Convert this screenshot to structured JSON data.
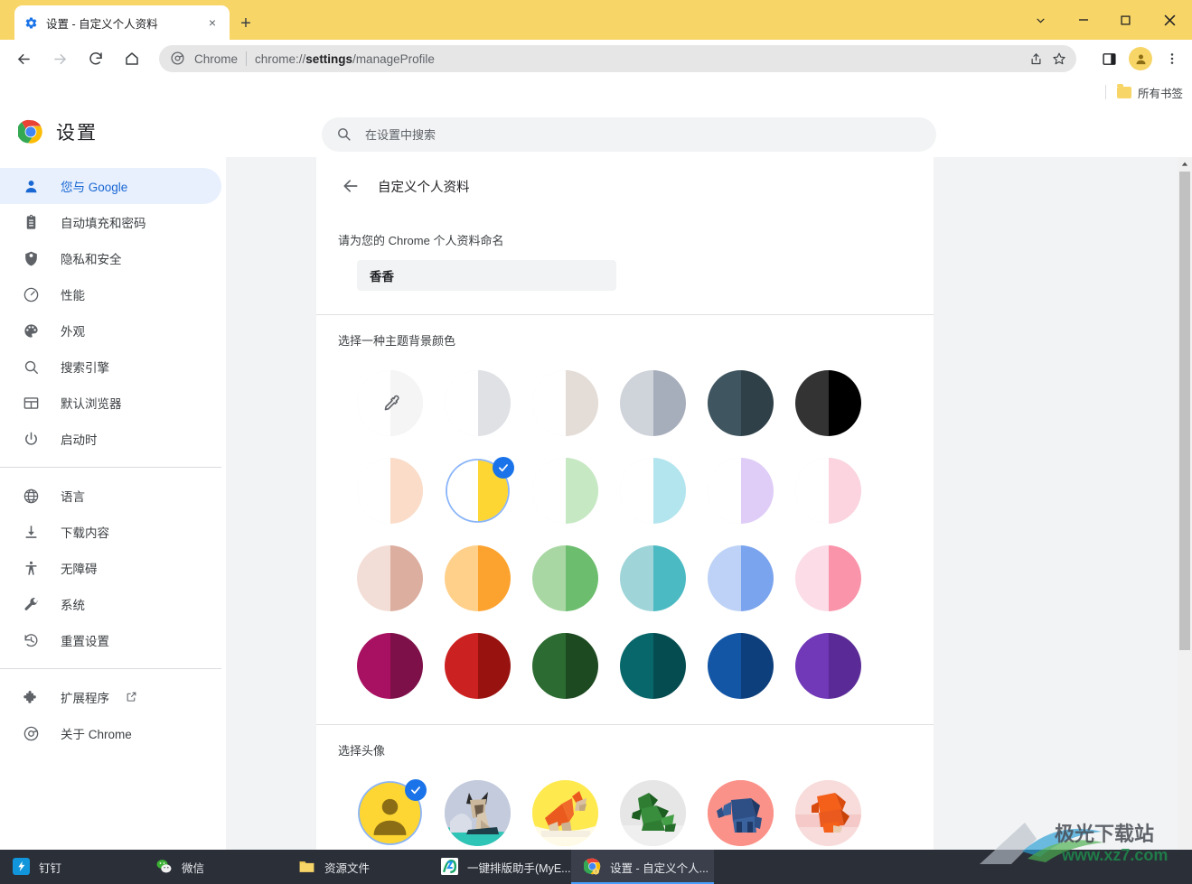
{
  "window": {
    "tab": {
      "title": "设置 - 自定义个人资料",
      "favicon": "gear-icon",
      "close": "×"
    },
    "new_tab": "+",
    "controls": {
      "minimize": "−",
      "maximize": "□",
      "close": "✕",
      "tab_search": "⌄"
    },
    "titlebar_color": "#f7d567"
  },
  "toolbar": {
    "back": "←",
    "forward": "→",
    "reload": "⟳",
    "home": "⌂",
    "omnibox": {
      "chrome_label": "Chrome",
      "url_prefix": "chrome://",
      "url_bold": "settings",
      "url_suffix": "/manageProfile",
      "full_url": "chrome://settings/manageProfile"
    },
    "share": "share-icon",
    "bookmark": "star-icon",
    "sidepanel": "side-panel-icon",
    "profile": "profile-avatar",
    "menu": "⋮"
  },
  "bookmark_bar": {
    "all_bookmarks": "所有书签"
  },
  "settings_header": {
    "title": "设置",
    "search_placeholder": "在设置中搜索",
    "search_value": ""
  },
  "sidebar": {
    "items": [
      {
        "label": "您与 Google",
        "icon": "person-icon",
        "active": true
      },
      {
        "label": "自动填充和密码",
        "icon": "clipboard-icon",
        "active": false
      },
      {
        "label": "隐私和安全",
        "icon": "shield-icon",
        "active": false
      },
      {
        "label": "性能",
        "icon": "gauge-icon",
        "active": false
      },
      {
        "label": "外观",
        "icon": "palette-icon",
        "active": false
      },
      {
        "label": "搜索引擎",
        "icon": "search-icon",
        "active": false
      },
      {
        "label": "默认浏览器",
        "icon": "browser-window-icon",
        "active": false
      },
      {
        "label": "启动时",
        "icon": "power-icon",
        "active": false
      }
    ],
    "items2": [
      {
        "label": "语言",
        "icon": "globe-icon"
      },
      {
        "label": "下载内容",
        "icon": "download-icon"
      },
      {
        "label": "无障碍",
        "icon": "accessibility-icon"
      },
      {
        "label": "系统",
        "icon": "wrench-icon"
      },
      {
        "label": "重置设置",
        "icon": "history-restore-icon"
      }
    ],
    "items3": [
      {
        "label": "扩展程序",
        "icon": "puzzle-icon",
        "external": true
      },
      {
        "label": "关于 Chrome",
        "icon": "chrome-logo-icon",
        "external": false
      }
    ]
  },
  "main": {
    "page_title": "自定义个人资料",
    "back_arrow": "←",
    "name_section": {
      "label": "请为您的 Chrome 个人资料命名",
      "value": "香香",
      "placeholder": ""
    },
    "theme_section": {
      "label": "选择一种主题背景颜色",
      "selected_index": 7,
      "swatches": [
        {
          "name": "custom-color",
          "left": "#ffffff",
          "right": "#f5f5f5",
          "outline": true,
          "eyedropper": true
        },
        {
          "name": "default-white",
          "left": "#ffffff",
          "right": "#dfe1e5",
          "outline": true
        },
        {
          "name": "warm-grey",
          "left": "#ffffff",
          "right": "#e4dcd6",
          "outline": true
        },
        {
          "name": "cool-grey",
          "left": "#cfd3da",
          "right": "#a7aebb",
          "outline": false
        },
        {
          "name": "dark-slate",
          "left": "#3f5560",
          "right": "#2f4049",
          "outline": false
        },
        {
          "name": "black",
          "left": "#333333",
          "right": "#000000",
          "outline": false
        },
        {
          "name": "light-peach",
          "left": "#ffffff",
          "right": "#fbdcc8",
          "outline": true
        },
        {
          "name": "yellow",
          "left": "#ffffff",
          "right": "#fdd633",
          "outline": false
        },
        {
          "name": "light-green",
          "left": "#ffffff",
          "right": "#c6e8c2",
          "outline": true
        },
        {
          "name": "light-cyan",
          "left": "#ffffff",
          "right": "#b3e5ef",
          "outline": true
        },
        {
          "name": "light-purple",
          "left": "#ffffff",
          "right": "#dfcdf7",
          "outline": true
        },
        {
          "name": "light-pink",
          "left": "#ffffff",
          "right": "#fbd4df",
          "outline": true
        },
        {
          "name": "rose-beige",
          "left": "#f3ded7",
          "right": "#dcae9f",
          "outline": false
        },
        {
          "name": "orange",
          "left": "#ffd08a",
          "right": "#fca22e",
          "outline": false
        },
        {
          "name": "green",
          "left": "#a8d7a3",
          "right": "#6cbd6e",
          "outline": false
        },
        {
          "name": "teal",
          "left": "#9fd5d8",
          "right": "#4cbac3",
          "outline": false
        },
        {
          "name": "blue",
          "left": "#bdd2f6",
          "right": "#7ba4ee",
          "outline": false
        },
        {
          "name": "pink",
          "left": "#fcdce6",
          "right": "#fa94ab",
          "outline": false
        },
        {
          "name": "magenta-dark",
          "left": "#a81161",
          "right": "#7d1049",
          "outline": false
        },
        {
          "name": "red-dark",
          "left": "#cb2120",
          "right": "#981210",
          "outline": false
        },
        {
          "name": "forest-green",
          "left": "#2c6b31",
          "right": "#1d4a21",
          "outline": false
        },
        {
          "name": "dark-teal",
          "left": "#08676a",
          "right": "#054c50",
          "outline": false
        },
        {
          "name": "navy-blue",
          "left": "#1356a5",
          "right": "#0d3f7c",
          "outline": false
        },
        {
          "name": "purple",
          "left": "#7138b8",
          "right": "#5a2b96",
          "outline": false
        }
      ]
    },
    "avatar_section": {
      "label": "选择头像",
      "selected_index": 0,
      "avatars": [
        {
          "name": "default-person-avatar",
          "bg": "#fdd633"
        },
        {
          "name": "origami-cat-avatar",
          "bg": "#c3cbdd"
        },
        {
          "name": "origami-dog-avatar",
          "bg": "#fee94f"
        },
        {
          "name": "origami-dragon-avatar",
          "bg": "#e3e3e3"
        },
        {
          "name": "origami-elephant-avatar",
          "bg": "#fb9289"
        },
        {
          "name": "origami-fox-avatar",
          "bg": "#f7dcdb"
        }
      ]
    }
  },
  "scrollbar": {
    "up": "▲",
    "down": "▼"
  },
  "taskbar": {
    "items": [
      {
        "label": "钉钉",
        "icon": "dingtalk-icon",
        "active": false
      },
      {
        "label": "微信",
        "icon": "wechat-icon",
        "active": false
      },
      {
        "label": "资源文件",
        "icon": "folder-icon",
        "active": false
      },
      {
        "label": "一键排版助手(MyE...",
        "icon": "typeset-helper-icon",
        "active": false
      },
      {
        "label": "设置 - 自定义个人...",
        "icon": "chrome-icon",
        "active": true
      }
    ]
  },
  "watermark": {
    "text": "www.xz7.com"
  }
}
